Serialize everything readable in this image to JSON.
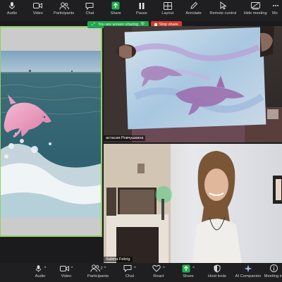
{
  "top_toolbar": {
    "items": [
      {
        "label": "Audio",
        "icon": "mic-icon"
      },
      {
        "label": "Video",
        "icon": "video-camera-icon"
      },
      {
        "label": "Participants",
        "icon": "participants-icon",
        "badge": "2"
      },
      {
        "label": "Chat",
        "icon": "chat-bubble-icon"
      },
      {
        "label": "Share",
        "icon": "share-screen-icon"
      },
      {
        "label": "Pause",
        "icon": "pause-icon"
      },
      {
        "label": "Layout",
        "icon": "layout-grid-icon"
      },
      {
        "label": "Annotate",
        "icon": "pencil-icon"
      },
      {
        "label": "Remote control",
        "icon": "remote-control-icon"
      },
      {
        "label": "Hide meeting",
        "icon": "hide-meeting-icon"
      },
      {
        "label": "Mo",
        "icon": "more-icon"
      }
    ]
  },
  "share_banner": {
    "status_text": "You are screen sharing",
    "stop_label": "Stop share"
  },
  "tiles": {
    "painting_name": "астасия Ровчушкина",
    "person_name": "Sabina Fekrig"
  },
  "bottom_toolbar": {
    "items": [
      {
        "label": "Audio",
        "icon": "mic-icon"
      },
      {
        "label": "Video",
        "icon": "video-camera-icon"
      },
      {
        "label": "Participants",
        "icon": "participants-icon",
        "badge": "2"
      },
      {
        "label": "Chat",
        "icon": "chat-bubble-icon"
      },
      {
        "label": "React",
        "icon": "heart-icon"
      },
      {
        "label": "Share",
        "icon": "share-screen-icon"
      },
      {
        "label": "Host tools",
        "icon": "shield-icon"
      },
      {
        "label": "AI Companion",
        "icon": "sparkle-icon"
      },
      {
        "label": "Meeting in",
        "icon": "info-icon"
      }
    ]
  },
  "colors": {
    "share_green": "#21a64a",
    "stop_red": "#d23b2f",
    "share_arrow_green": "#1fb14c",
    "frame_green": "#8fd15d"
  }
}
